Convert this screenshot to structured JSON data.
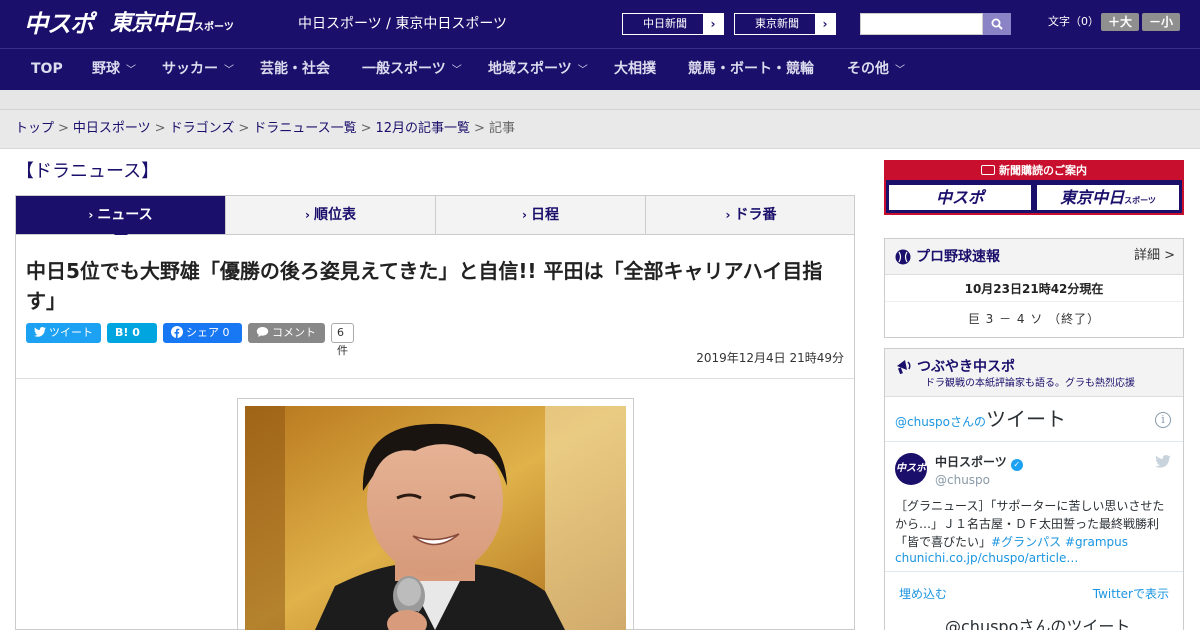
{
  "header": {
    "logo_chuspo": "中スポ",
    "logo_tokyo": "東京中日",
    "logo_tokyo_sub": "スポーツ",
    "site_name": "中日スポーツ / 東京中日スポーツ",
    "chunichi_link": "中日新聞",
    "tokyo_link": "東京新聞",
    "link_arrow": "›",
    "search_placeholder": "",
    "font_size_label": "文字（0）",
    "font_larger": "＋大",
    "font_smaller": "－小"
  },
  "nav": {
    "items": [
      {
        "label": "TOP"
      },
      {
        "label": "野球"
      },
      {
        "label": "サッカー"
      },
      {
        "label": "芸能・社会"
      },
      {
        "label": "一般スポーツ"
      },
      {
        "label": "地域スポーツ"
      },
      {
        "label": "大相撲"
      },
      {
        "label": "競馬・ボート・競輪"
      },
      {
        "label": "その他"
      }
    ]
  },
  "breadcrumb": {
    "items": [
      "トップ",
      "中日スポーツ",
      "ドラゴンズ",
      "ドラニュース一覧",
      "12月の記事一覧"
    ],
    "current": "記事",
    "separator": ">"
  },
  "section_title": "【ドラニュース】",
  "tabs": [
    {
      "label": "ニュース",
      "active": true
    },
    {
      "label": "順位表",
      "active": false
    },
    {
      "label": "日程",
      "active": false
    },
    {
      "label": "ドラ番",
      "active": false
    }
  ],
  "tab_marker": "›",
  "article": {
    "headline": "中日5位でも大野雄「優勝の後ろ姿見えてきた」と自信!! 平田は「全部キャリアハイ目指す」",
    "share": {
      "tweet_label": "ツイート",
      "hatena_label": "B! 0",
      "facebook_label": "シェア 0",
      "comment_label": "コメント",
      "comment_count": "6件"
    },
    "date": "2019年12月4日 21時49分"
  },
  "sidebar": {
    "subscription": {
      "title": "新聞購読のご案内",
      "logo_chuspo": "中スポ",
      "logo_tokyo": "東京中日",
      "logo_tokyo_sub": "スポーツ"
    },
    "baseball": {
      "title": "プロ野球速報",
      "more": "詳細 >",
      "time": "10月23日21時42分現在",
      "score": "巨 3 － 4 ソ （終了）"
    },
    "tweets": {
      "title": "つぶやき中スポ",
      "subtitle": "ドラ観戦の本紙評論家も語る。グラも熱烈応援",
      "timeline_prefix": "@chuspoさんの",
      "timeline_big": "ツイート",
      "info": "i",
      "avatar_text": "中スポ",
      "user_name": "中日スポーツ",
      "verified_mark": "✓",
      "user_handle": "@chuspo",
      "tweet_text": "［グラニュース］「サポーターに苦しい思いさせたから…」Ｊ１名古屋・ＤＦ太田誓った最終戦勝利「皆で喜びたい」",
      "hashtags": "#グランパス #grampus",
      "link": "chunichi.co.jp/chuspo/article…",
      "embed": "埋め込む",
      "view_on_twitter": "Twitterで表示",
      "bottom_title": "@chuspoさんのツイート"
    }
  }
}
